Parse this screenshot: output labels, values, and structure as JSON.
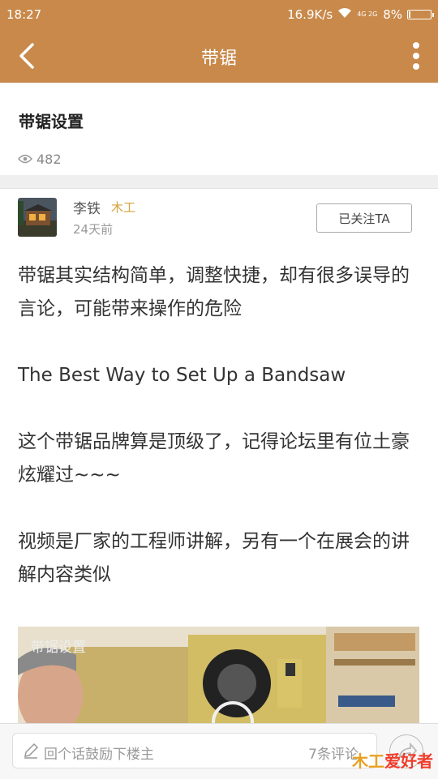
{
  "status": {
    "time": "18:27",
    "net_speed": "16.9K/s",
    "signal": "4G 2G",
    "battery": "8%",
    "battery_level": 0.08
  },
  "app_bar": {
    "title": "带锯"
  },
  "post": {
    "title": "带锯设置",
    "views": "482"
  },
  "author": {
    "name": "李铁",
    "tag": "木工",
    "date": "24天前",
    "follow_label": "已关注TA"
  },
  "content": {
    "paragraphs": [
      "带锯其实结构简单，调整快捷，却有很多误导的言论，可能带来操作的危险",
      "The Best Way to Set Up a Bandsaw",
      "这个带锯品牌算是顶级了，记得论坛里有位土豪炫耀过~~~",
      "视频是厂家的工程师讲解，另有一个在展会的讲解内容类似"
    ]
  },
  "video": {
    "label": "带锯设置"
  },
  "bottom": {
    "placeholder": "回个话鼓励下楼主",
    "comment_count": "7条评论",
    "watermark_a": "木工",
    "watermark_b": "爱好者"
  },
  "colors": {
    "header": "#c8894a",
    "author_tag": "#d4a23a",
    "watermark": "#f03c2a"
  }
}
